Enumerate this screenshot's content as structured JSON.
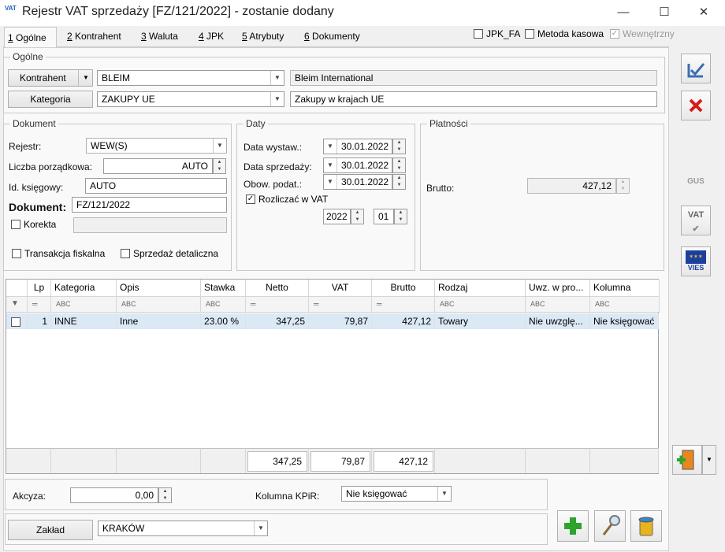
{
  "window": {
    "icon_text": "VAT",
    "title": "Rejestr VAT sprzedaży [FZ/121/2022] - zostanie dodany",
    "minimize": "—",
    "maximize": "☐",
    "close": "✕"
  },
  "tabs": [
    {
      "key": "1",
      "label": " Ogólne"
    },
    {
      "key": "2",
      "label": " Kontrahent"
    },
    {
      "key": "3",
      "label": " Waluta"
    },
    {
      "key": "4",
      "label": " JPK"
    },
    {
      "key": "5",
      "label": " Atrybuty"
    },
    {
      "key": "6",
      "label": " Dokumenty"
    }
  ],
  "top_checks": {
    "jpk_fa": "JPK_FA",
    "metoda_kasowa": "Metoda kasowa",
    "wewnetrzny": "Wewnętrzny"
  },
  "ogolne": {
    "title": "Ogólne",
    "kontrahent_btn": "Kontrahent",
    "kontrahent_code": "BLEIM",
    "kontrahent_name": "Bleim International",
    "kategoria_btn": "Kategoria",
    "kategoria_code": "ZAKUPY UE",
    "kategoria_desc": "Zakupy w krajach UE"
  },
  "dokument": {
    "title": "Dokument",
    "rejestr_label": "Rejestr:",
    "rejestr_value": "WEW(S)",
    "lp_label": "Liczba porządkowa:",
    "lp_value": "AUTO",
    "id_label": "Id. księgowy:",
    "id_value": "AUTO",
    "dok_label": "Dokument:",
    "dok_value": "FZ/121/2022",
    "korekta": "Korekta",
    "transakcja": "Transakcja fiskalna",
    "sprzedaz": "Sprzedaż detaliczna"
  },
  "daty": {
    "title": "Daty",
    "wystaw_label": "Data wystaw.:",
    "wystaw": "30.01.2022",
    "sprzedazy_label": "Data sprzedaży:",
    "sprzedazy": "30.01.2022",
    "obow_label": "Obow. podat.:",
    "obow": "30.01.2022",
    "rozliczac": "Rozliczać w VAT",
    "rok": "2022",
    "miesiac": "01"
  },
  "platnosci": {
    "title": "Płatności",
    "brutto_label": "Brutto:",
    "brutto": "427,12"
  },
  "grid": {
    "columns": [
      "",
      "Lp",
      "Kategoria",
      "Opis",
      "Stawka",
      "Netto",
      "VAT",
      "Brutto",
      "Rodzaj",
      "Uwz. w pro...",
      "Kolumna"
    ],
    "filters": [
      "",
      "═",
      "ABC",
      "ABC",
      "ABC",
      "═",
      "═",
      "═",
      "ABC",
      "ABC",
      "ABC"
    ],
    "rows": [
      {
        "lp": "1",
        "kategoria": "INNE",
        "opis": "Inne",
        "stawka": "23.00 %",
        "netto": "347,25",
        "vat": "79,87",
        "brutto": "427,12",
        "rodzaj": "Towary",
        "uwz": "Nie uwzglę...",
        "kolumna": "Nie księgować"
      }
    ],
    "totals": {
      "netto": "347,25",
      "vat": "79,87",
      "brutto": "427,12"
    }
  },
  "bottom": {
    "akcyza_label": "Akcyza:",
    "akcyza": "0,00",
    "kpir_label": "Kolumna KPiR:",
    "kpir": "Nie księgować",
    "zaklad_btn": "Zakład",
    "zaklad": "KRAKÓW"
  },
  "side": {
    "gus": "GUS",
    "vat": "VAT",
    "vies": "VIES"
  }
}
